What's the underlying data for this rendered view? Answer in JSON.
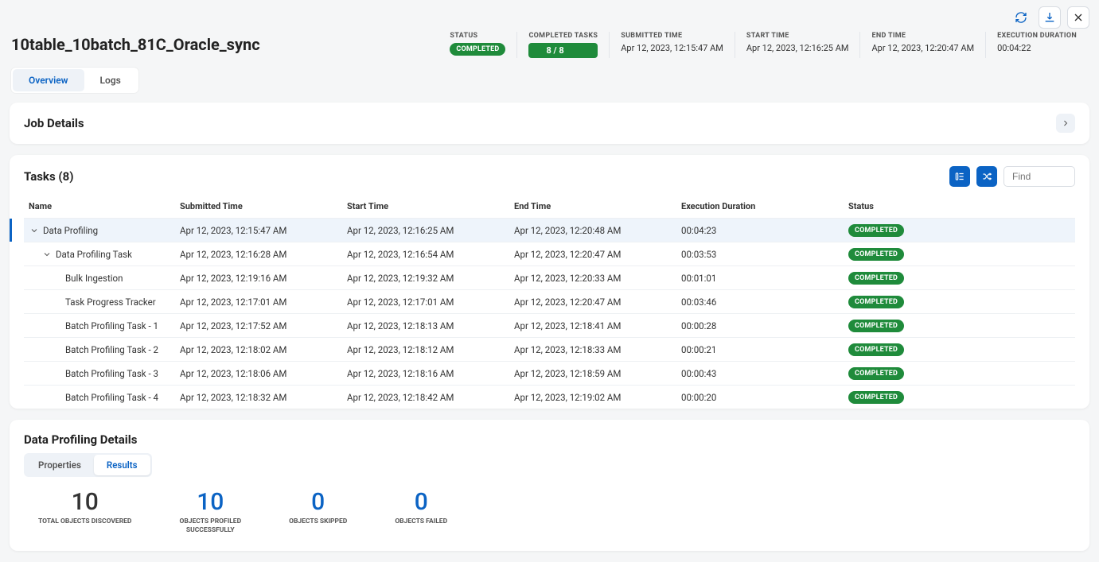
{
  "title": "10table_10batch_81C_Oracle_sync",
  "meta": {
    "status_label": "STATUS",
    "status_value": "COMPLETED",
    "completed_tasks_label": "COMPLETED TASKS",
    "completed_tasks_value": "8 / 8",
    "submitted_label": "SUBMITTED TIME",
    "submitted_value": "Apr 12, 2023, 12:15:47 AM",
    "start_label": "START TIME",
    "start_value": "Apr 12, 2023, 12:16:25 AM",
    "end_label": "END TIME",
    "end_value": "Apr 12, 2023, 12:20:47 AM",
    "duration_label": "EXECUTION DURATION",
    "duration_value": "00:04:22"
  },
  "tabs": {
    "overview": "Overview",
    "logs": "Logs"
  },
  "job_details_title": "Job Details",
  "tasks_title": "Tasks (8)",
  "find_placeholder": "Find",
  "columns": {
    "name": "Name",
    "submitted": "Submitted Time",
    "start": "Start Time",
    "end": "End Time",
    "duration": "Execution Duration",
    "status": "Status"
  },
  "rows": [
    {
      "name": "Data Profiling",
      "submitted": "Apr 12, 2023, 12:15:47 AM",
      "start": "Apr 12, 2023, 12:16:25 AM",
      "end": "Apr 12, 2023, 12:20:48 AM",
      "duration": "00:04:23",
      "status": "COMPLETED",
      "indent": 0,
      "toggle": true,
      "selected": true
    },
    {
      "name": "Data Profiling Task",
      "submitted": "Apr 12, 2023, 12:16:28 AM",
      "start": "Apr 12, 2023, 12:16:54 AM",
      "end": "Apr 12, 2023, 12:20:47 AM",
      "duration": "00:03:53",
      "status": "COMPLETED",
      "indent": 1,
      "toggle": true
    },
    {
      "name": "Bulk Ingestion",
      "submitted": "Apr 12, 2023, 12:19:16 AM",
      "start": "Apr 12, 2023, 12:19:32 AM",
      "end": "Apr 12, 2023, 12:20:33 AM",
      "duration": "00:01:01",
      "status": "COMPLETED",
      "indent": 2
    },
    {
      "name": "Task Progress Tracker",
      "submitted": "Apr 12, 2023, 12:17:01 AM",
      "start": "Apr 12, 2023, 12:17:01 AM",
      "end": "Apr 12, 2023, 12:20:47 AM",
      "duration": "00:03:46",
      "status": "COMPLETED",
      "indent": 2
    },
    {
      "name": "Batch Profiling Task - 1",
      "submitted": "Apr 12, 2023, 12:17:52 AM",
      "start": "Apr 12, 2023, 12:18:13 AM",
      "end": "Apr 12, 2023, 12:18:41 AM",
      "duration": "00:00:28",
      "status": "COMPLETED",
      "indent": 2
    },
    {
      "name": "Batch Profiling Task - 2",
      "submitted": "Apr 12, 2023, 12:18:02 AM",
      "start": "Apr 12, 2023, 12:18:12 AM",
      "end": "Apr 12, 2023, 12:18:33 AM",
      "duration": "00:00:21",
      "status": "COMPLETED",
      "indent": 2
    },
    {
      "name": "Batch Profiling Task - 3",
      "submitted": "Apr 12, 2023, 12:18:06 AM",
      "start": "Apr 12, 2023, 12:18:16 AM",
      "end": "Apr 12, 2023, 12:18:59 AM",
      "duration": "00:00:43",
      "status": "COMPLETED",
      "indent": 2
    },
    {
      "name": "Batch Profiling Task - 4",
      "submitted": "Apr 12, 2023, 12:18:32 AM",
      "start": "Apr 12, 2023, 12:18:42 AM",
      "end": "Apr 12, 2023, 12:19:02 AM",
      "duration": "00:00:20",
      "status": "COMPLETED",
      "indent": 2
    }
  ],
  "dp_title": "Data Profiling Details",
  "dp_tabs": {
    "properties": "Properties",
    "results": "Results"
  },
  "stats": [
    {
      "value": "10",
      "label": "TOTAL OBJECTS DISCOVERED",
      "blue": false
    },
    {
      "value": "10",
      "label": "OBJECTS PROFILED\nSUCCESSFULLY",
      "blue": true
    },
    {
      "value": "0",
      "label": "OBJECTS SKIPPED",
      "blue": true
    },
    {
      "value": "0",
      "label": "OBJECTS FAILED",
      "blue": true
    }
  ]
}
